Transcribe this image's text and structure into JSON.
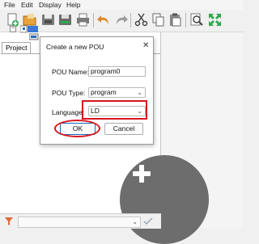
{
  "menu": [
    "File",
    "Edit",
    "Display",
    "Help"
  ],
  "toolbar": {
    "icons": [
      "new-file-icon",
      "open-folder-icon",
      "save-icon",
      "save-as-icon",
      "print-icon",
      "undo-icon",
      "redo-icon",
      "cut-icon",
      "copy-icon",
      "paste-icon",
      "zoom-icon",
      "fullscreen-icon"
    ]
  },
  "panel": {
    "tab_label": "Project"
  },
  "dialog": {
    "title": "Create a new POU",
    "close_glyph": "✕",
    "pou_name_label": "POU Name:",
    "pou_name_value": "program0",
    "pou_type_label": "POU Type:",
    "pou_type_value": "program",
    "language_label": "Language:",
    "language_value": "LD",
    "ok_label": "OK",
    "cancel_label": "Cancel"
  },
  "colors": {
    "highlight": "#d8141c",
    "fab": "#6d6d6d",
    "ok_border": "#0f6cbd"
  }
}
